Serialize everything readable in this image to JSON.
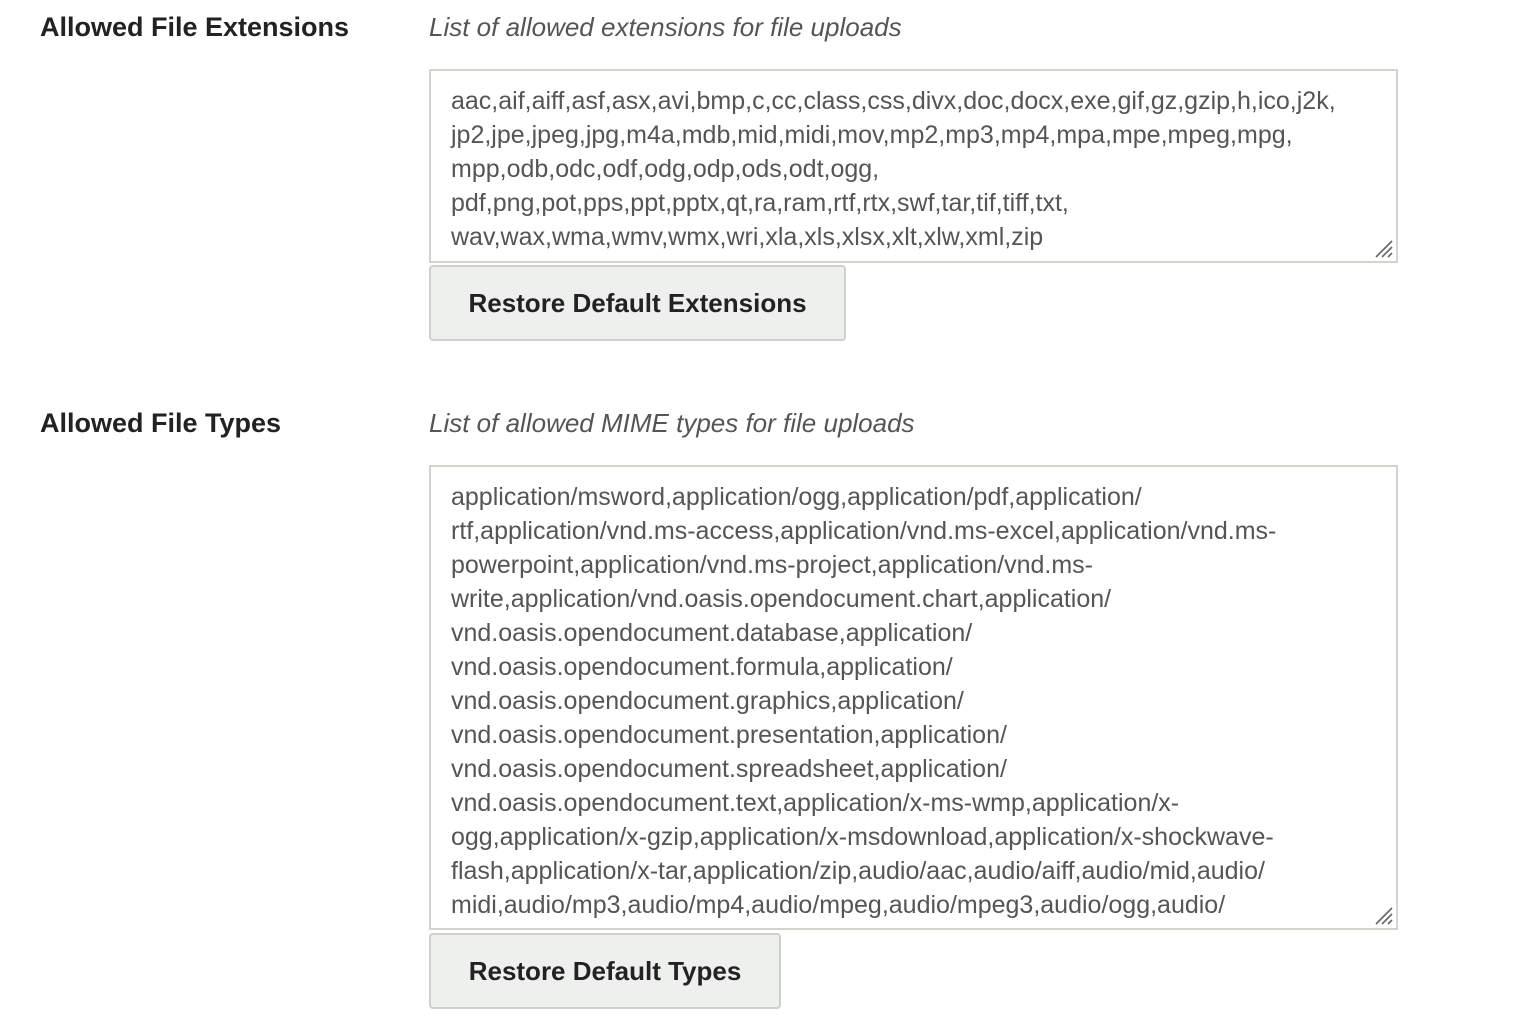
{
  "extensions": {
    "label": "Allowed File Extensions",
    "description": "List of allowed extensions for file uploads",
    "value": "aac,aif,aiff,asf,asx,avi,bmp,c,cc,class,css,divx,doc,docx,exe,gif,gz,gzip,h,ico,j2k,\njp2,jpe,jpeg,jpg,m4a,mdb,mid,midi,mov,mp2,mp3,mp4,mpa,mpe,mpeg,mpg,\nmpp,odb,odc,odf,odg,odp,ods,odt,ogg,\npdf,png,pot,pps,ppt,pptx,qt,ra,ram,rtf,rtx,swf,tar,tif,tiff,txt,\nwav,wax,wma,wmv,wmx,wri,xla,xls,xlsx,xlt,xlw,xml,zip",
    "restore_button": "Restore Default Extensions"
  },
  "types": {
    "label": "Allowed File Types",
    "description": "List of allowed MIME types for file uploads",
    "value": "application/msword,application/ogg,application/pdf,application/\nrtf,application/vnd.ms-access,application/vnd.ms-excel,application/vnd.ms-\npowerpoint,application/vnd.ms-project,application/vnd.ms-\nwrite,application/vnd.oasis.opendocument.chart,application/\nvnd.oasis.opendocument.database,application/\nvnd.oasis.opendocument.formula,application/\nvnd.oasis.opendocument.graphics,application/\nvnd.oasis.opendocument.presentation,application/\nvnd.oasis.opendocument.spreadsheet,application/\nvnd.oasis.opendocument.text,application/x-ms-wmp,application/x-\nogg,application/x-gzip,application/x-msdownload,application/x-shockwave-\nflash,application/x-tar,application/zip,audio/aac,audio/aiff,audio/mid,audio/\nmidi,audio/mp3,audio/mp4,audio/mpeg,audio/mpeg3,audio/ogg,audio/",
    "restore_button": "Restore Default Types"
  }
}
